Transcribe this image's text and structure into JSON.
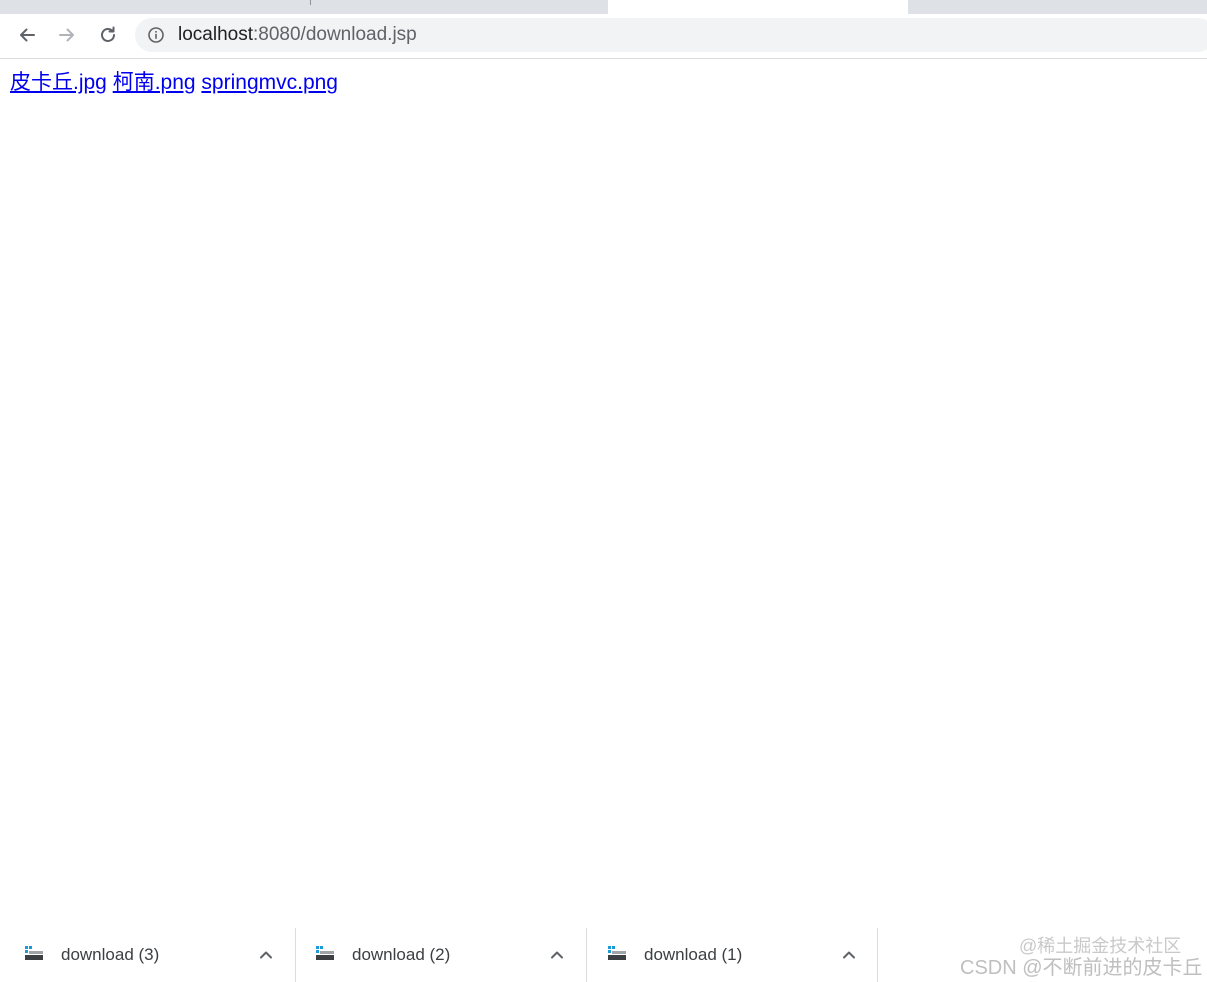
{
  "browser": {
    "url_host": "localhost",
    "url_path": ":8080/download.jsp"
  },
  "page": {
    "links": [
      "皮卡丘.jpg",
      "柯南.png",
      "springmvc.png"
    ]
  },
  "downloads": [
    {
      "name": "download (3)"
    },
    {
      "name": "download (2)"
    },
    {
      "name": "download (1)"
    }
  ],
  "watermark": {
    "line1": "@稀土掘金技术社区",
    "line2": "CSDN @不断前进的皮卡丘"
  },
  "icons": {
    "back": "arrow-left-icon",
    "forward": "arrow-right-icon",
    "reload": "reload-icon",
    "info": "info-circle-icon",
    "file": "file-icon",
    "chevron": "chevron-up-icon"
  }
}
